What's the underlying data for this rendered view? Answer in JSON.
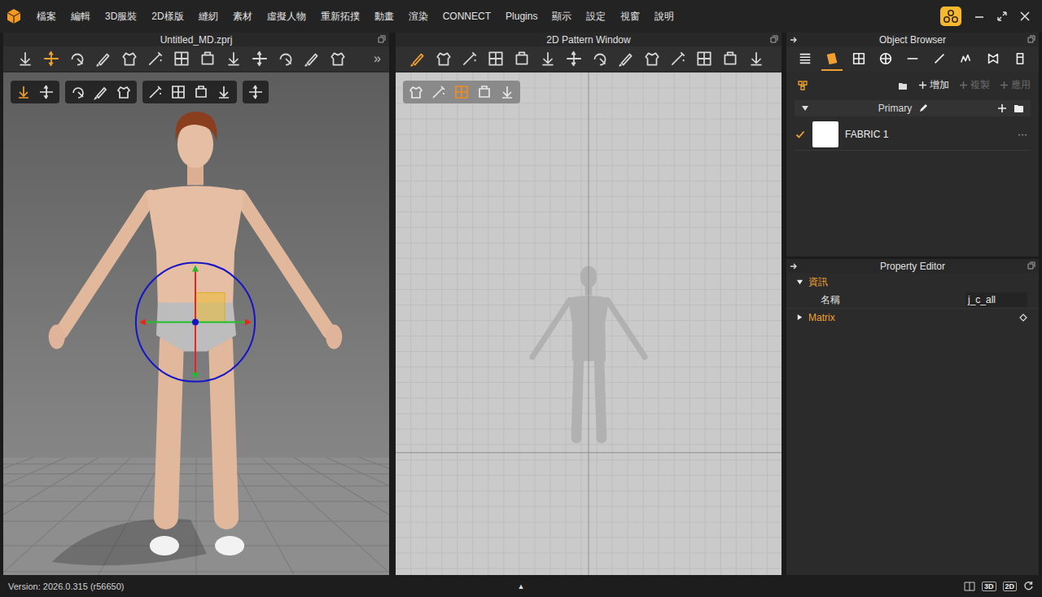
{
  "menu": [
    "檔案",
    "編輯",
    "3D服裝",
    "2D樣版",
    "縫紉",
    "素材",
    "虛擬人物",
    "重新拓撲",
    "動畫",
    "渲染",
    "CONNECT",
    "Plugins",
    "顯示",
    "設定",
    "視窗",
    "說明"
  ],
  "viewport3d": {
    "title": "Untitled_MD.zprj",
    "toolbar_overflow": "»"
  },
  "pattern2d": {
    "title": "2D Pattern Window"
  },
  "object_browser": {
    "title": "Object Browser",
    "tabs": [
      {
        "selected": false
      },
      {
        "selected": true
      },
      {
        "selected": false
      },
      {
        "selected": false
      },
      {
        "selected": false
      },
      {
        "selected": false
      },
      {
        "selected": false
      },
      {
        "selected": false
      },
      {
        "selected": false
      }
    ],
    "actions": [
      {
        "label": "增加",
        "disabled": false
      },
      {
        "label": "複製",
        "disabled": true
      },
      {
        "label": "應用",
        "disabled": true
      }
    ],
    "group": {
      "label": "Primary",
      "expanded": true
    },
    "items": [
      {
        "label": "FABRIC 1",
        "selected": true,
        "color": "#ffffff",
        "menu": "···"
      }
    ]
  },
  "property_editor": {
    "title": "Property Editor",
    "sections": [
      {
        "label": "資訊",
        "expanded": true,
        "fields": [
          {
            "label": "名稱",
            "value": "j_c_all"
          }
        ]
      },
      {
        "label": "Matrix",
        "expanded": false,
        "fields": []
      }
    ]
  },
  "status_bar": {
    "version": "Version: 2026.0.315 (r56650)",
    "center": "▲",
    "views": [
      "3D",
      "2D"
    ]
  }
}
